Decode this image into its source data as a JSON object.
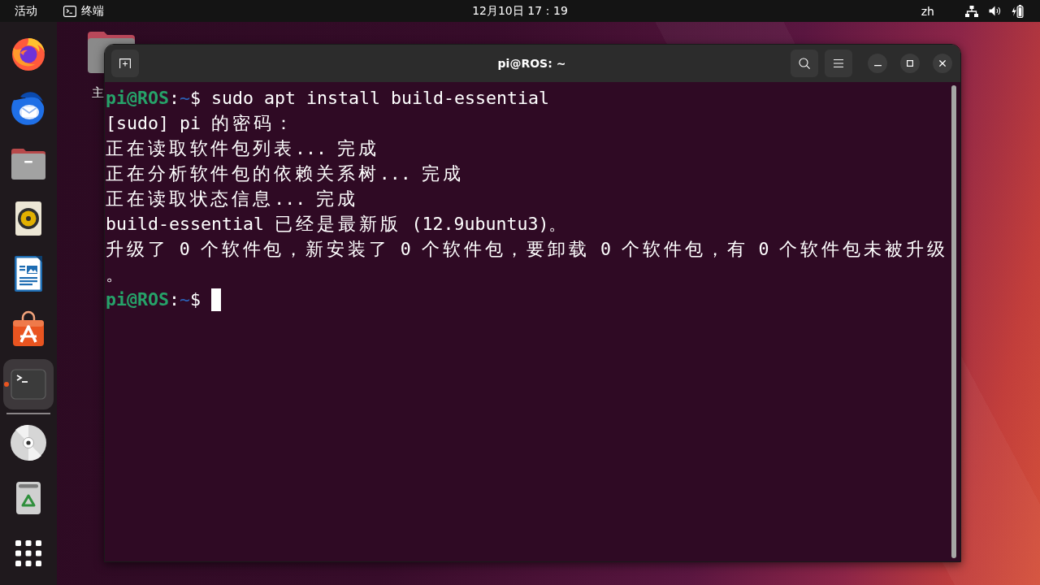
{
  "top_bar": {
    "activities": "活动",
    "app_menu": "终端",
    "clock": "12月10日 17：19",
    "input_method": "zh"
  },
  "desktop_icons": [
    {
      "label": "主"
    }
  ],
  "dock": {
    "items": [
      {
        "kind": "browser",
        "selected": false,
        "running": false
      },
      {
        "kind": "mail",
        "selected": false,
        "running": false
      },
      {
        "kind": "files",
        "selected": false,
        "running": false
      },
      {
        "kind": "music",
        "selected": false,
        "running": false
      },
      {
        "kind": "writer",
        "selected": false,
        "running": false
      },
      {
        "kind": "store",
        "selected": false,
        "running": false
      },
      {
        "kind": "terminal",
        "selected": true,
        "running": true
      }
    ],
    "after_separator": [
      {
        "kind": "disc",
        "selected": false,
        "running": false
      },
      {
        "kind": "trash",
        "selected": false,
        "running": false
      }
    ]
  },
  "terminal": {
    "title": "pi@ROS: ~",
    "lines": [
      {
        "kind": "prompt",
        "host": "pi@ROS",
        "colon": ":",
        "path": "~",
        "symbol": "$",
        "command": "sudo apt install build-essential",
        "cursor": false
      },
      {
        "kind": "output",
        "text": "[sudo] pi 的密码："
      },
      {
        "kind": "output",
        "text": "正在读取软件包列表... 完成"
      },
      {
        "kind": "output",
        "text": "正在分析软件包的依赖关系树... 完成"
      },
      {
        "kind": "output",
        "text": "正在读取状态信息... 完成"
      },
      {
        "kind": "output",
        "text": "build-essential 已经是最新版 (12.9ubuntu3)。"
      },
      {
        "kind": "output",
        "text": "升级了 0 个软件包，新安装了 0 个软件包，要卸载 0 个软件包，有 0 个软件包未被升级"
      },
      {
        "kind": "output",
        "text": "。"
      },
      {
        "kind": "prompt",
        "host": "pi@ROS",
        "colon": ":",
        "path": "~",
        "symbol": "$",
        "cursor": true
      }
    ]
  }
}
